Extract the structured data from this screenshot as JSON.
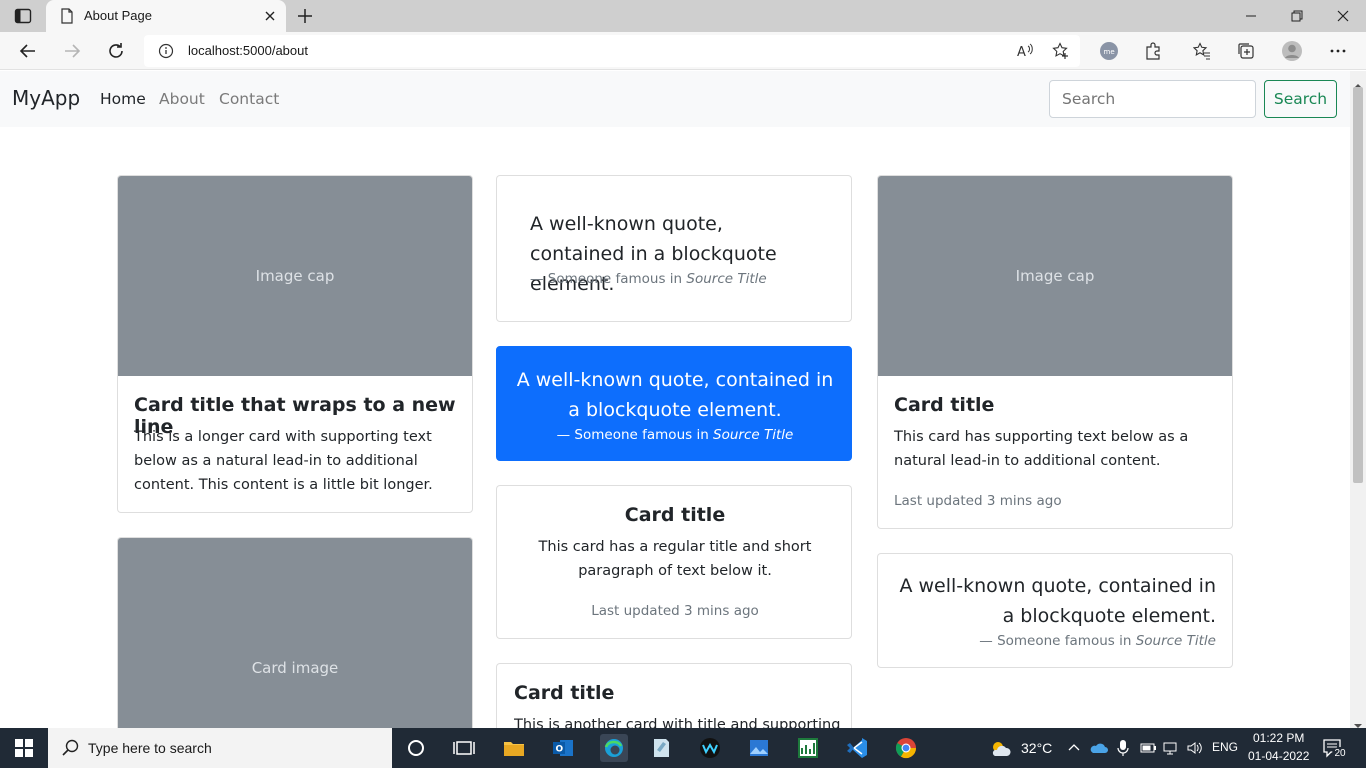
{
  "browser": {
    "tab_title": "About Page",
    "url": "localhost:5000/about"
  },
  "navbar": {
    "brand": "MyApp",
    "links": [
      {
        "label": "Home",
        "active": true
      },
      {
        "label": "About",
        "active": false
      },
      {
        "label": "Contact",
        "active": false
      }
    ],
    "search_placeholder": "Search",
    "search_button": "Search"
  },
  "cards": {
    "card1": {
      "image_caption": "Image cap",
      "title": "Card title that wraps to a new line",
      "text": "This is a longer card with supporting text below as a natural lead-in to additional content. This content is a little bit longer."
    },
    "card2": {
      "image_caption": "Card image"
    },
    "quote1": {
      "text": "A well-known quote, contained in a blockquote element.",
      "footer_prefix": "— Someone famous in ",
      "footer_source": "Source Title"
    },
    "quote2": {
      "text": "A well-known quote, contained in a blockquote element.",
      "footer_prefix": "— Someone famous in ",
      "footer_source": "Source Title"
    },
    "card3": {
      "title": "Card title",
      "text": "This card has a regular title and short paragraph of text below it.",
      "muted": "Last updated 3 mins ago"
    },
    "card4": {
      "title": "Card title",
      "text": "This is another card with title and supporting"
    },
    "card5": {
      "image_caption": "Image cap",
      "title": "Card title",
      "text": "This card has supporting text below as a natural lead-in to additional content.",
      "muted": "Last updated 3 mins ago"
    },
    "quote3": {
      "text": "A well-known quote, contained in a blockquote element.",
      "footer_prefix": "— Someone famous in ",
      "footer_source": "Source Title"
    }
  },
  "colors": {
    "primary": "#0d6efd",
    "success": "#198754",
    "placeholder_gray": "#868e96"
  },
  "taskbar": {
    "search_placeholder": "Type here to search",
    "temperature": "32°C",
    "language": "ENG",
    "time": "01:22 PM",
    "date": "01-04-2022",
    "notification_count": "20"
  }
}
